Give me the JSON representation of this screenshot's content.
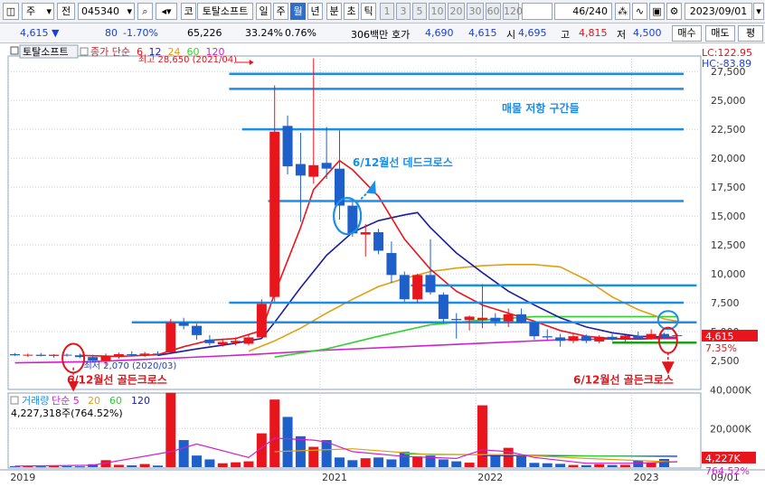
{
  "toolbar": {
    "type_label": "주",
    "prev_label": "전",
    "code": "045340",
    "name": "토탈소프트",
    "periods": [
      "일",
      "주",
      "월",
      "년",
      "분",
      "초",
      "틱"
    ],
    "selected_period": "월",
    "intervals": [
      "1",
      "3",
      "5",
      "10",
      "20",
      "30",
      "60",
      "120"
    ],
    "count": "46",
    "count_total": "/240",
    "date": "2023/09/01",
    "code_prefix": "코"
  },
  "quote": {
    "price": "4,615",
    "change": "80",
    "change_pct": "-1.70%",
    "volume": "65,226",
    "turnover": "33.24%",
    "pct2": "0.76%",
    "amount": "306백만",
    "ask_label": "호가",
    "ask": "4,690",
    "bid": "4,615",
    "open_label": "시",
    "open": "4,695",
    "high_label": "고",
    "high": "4,815",
    "low_label": "저",
    "low": "4,500",
    "buy_label": "매수",
    "sell_label": "매도",
    "eval_label": "평"
  },
  "colors": {
    "up": "#e8161c",
    "down": "#1f5fc9",
    "ma6": "#e8161c",
    "ma12": "#1a1fa0",
    "ma24": "#e0a010",
    "ma60": "#30d030",
    "ma120": "#d020d0",
    "hline": "#1a8ee8",
    "grid": "#c8d0dc"
  },
  "chart_data": [
    {
      "type": "candlestick",
      "title": "토탈소프트",
      "legend": [
        {
          "label": "종가 단순",
          "color": "#e8161c"
        },
        {
          "label": "6",
          "color": "#e8161c"
        },
        {
          "label": "12",
          "color": "#1a1fa0"
        },
        {
          "label": "24",
          "color": "#e0a010"
        },
        {
          "label": "60",
          "color": "#30d030"
        },
        {
          "label": "120",
          "color": "#d020d0"
        }
      ],
      "ylim": [
        0,
        30000
      ],
      "yticks": [
        "2,500",
        "5,000",
        "7,500",
        "10,000",
        "12,500",
        "15,000",
        "17,500",
        "20,000",
        "22,500",
        "25,000",
        "27,500"
      ],
      "ytick_values": [
        2500,
        5000,
        7500,
        10000,
        12500,
        15000,
        17500,
        20000,
        22500,
        25000,
        27500
      ],
      "xlabels": [
        {
          "label": "2019",
          "month": 0
        },
        {
          "label": "2021",
          "month": 24
        },
        {
          "label": "2022",
          "month": 36
        },
        {
          "label": "2023",
          "month": 48
        }
      ],
      "top_right_labels": {
        "lc": "LC:122.95",
        "hc": "HC:-83.89"
      },
      "current_price_label": "4,615",
      "current_pct_label": "7.35%",
      "candles": [
        {
          "m": 0,
          "o": 3050,
          "h": 3150,
          "l": 2900,
          "c": 2950
        },
        {
          "m": 1,
          "o": 2950,
          "h": 3100,
          "l": 2800,
          "c": 3000
        },
        {
          "m": 2,
          "o": 3000,
          "h": 3150,
          "l": 2850,
          "c": 2900
        },
        {
          "m": 3,
          "o": 2900,
          "h": 3050,
          "l": 2750,
          "c": 3000
        },
        {
          "m": 4,
          "o": 3000,
          "h": 3100,
          "l": 2850,
          "c": 2950
        },
        {
          "m": 5,
          "o": 2950,
          "h": 3100,
          "l": 2700,
          "c": 2800
        },
        {
          "m": 6,
          "o": 2800,
          "h": 3000,
          "l": 2300,
          "c": 2500
        },
        {
          "m": 7,
          "o": 2500,
          "h": 3100,
          "l": 2070,
          "c": 2900
        },
        {
          "m": 8,
          "o": 2900,
          "h": 3200,
          "l": 2650,
          "c": 3050
        },
        {
          "m": 9,
          "o": 3050,
          "h": 3300,
          "l": 2850,
          "c": 3000
        },
        {
          "m": 10,
          "o": 3000,
          "h": 3250,
          "l": 2800,
          "c": 3100
        },
        {
          "m": 11,
          "o": 3100,
          "h": 3300,
          "l": 2900,
          "c": 3050
        },
        {
          "m": 12,
          "o": 3200,
          "h": 6100,
          "l": 3150,
          "c": 5800
        },
        {
          "m": 13,
          "o": 5800,
          "h": 6200,
          "l": 5200,
          "c": 5500
        },
        {
          "m": 14,
          "o": 5500,
          "h": 5700,
          "l": 4300,
          "c": 4700
        },
        {
          "m": 15,
          "o": 4300,
          "h": 4700,
          "l": 3800,
          "c": 4000
        },
        {
          "m": 16,
          "o": 3900,
          "h": 4400,
          "l": 3700,
          "c": 4100
        },
        {
          "m": 17,
          "o": 4050,
          "h": 4500,
          "l": 3800,
          "c": 4200
        },
        {
          "m": 18,
          "o": 3950,
          "h": 4800,
          "l": 3800,
          "c": 4500
        },
        {
          "m": 19,
          "o": 4500,
          "h": 7800,
          "l": 4400,
          "c": 7400
        },
        {
          "m": 20,
          "o": 8000,
          "h": 26300,
          "l": 7600,
          "c": 22300
        },
        {
          "m": 21,
          "o": 22800,
          "h": 23700,
          "l": 18600,
          "c": 19300
        },
        {
          "m": 22,
          "o": 19500,
          "h": 22200,
          "l": 14500,
          "c": 18500
        },
        {
          "m": 23,
          "o": 18400,
          "h": 28650,
          "l": 17800,
          "c": 19400
        },
        {
          "m": 24,
          "o": 19600,
          "h": 22700,
          "l": 18200,
          "c": 19100
        },
        {
          "m": 25,
          "o": 19100,
          "h": 22400,
          "l": 14700,
          "c": 15900
        },
        {
          "m": 26,
          "o": 15900,
          "h": 16200,
          "l": 13200,
          "c": 13500
        },
        {
          "m": 27,
          "o": 13400,
          "h": 14300,
          "l": 11500,
          "c": 13600
        },
        {
          "m": 28,
          "o": 13600,
          "h": 13900,
          "l": 11700,
          "c": 12000
        },
        {
          "m": 29,
          "o": 11800,
          "h": 12800,
          "l": 9200,
          "c": 9900
        },
        {
          "m": 30,
          "o": 9900,
          "h": 10200,
          "l": 7600,
          "c": 7800
        },
        {
          "m": 31,
          "o": 7800,
          "h": 10000,
          "l": 7500,
          "c": 9900
        },
        {
          "m": 32,
          "o": 9900,
          "h": 13000,
          "l": 8200,
          "c": 8400
        },
        {
          "m": 33,
          "o": 8200,
          "h": 8400,
          "l": 5800,
          "c": 6100
        },
        {
          "m": 34,
          "o": 6100,
          "h": 6600,
          "l": 4400,
          "c": 6000
        },
        {
          "m": 35,
          "o": 6000,
          "h": 6400,
          "l": 5100,
          "c": 6300
        },
        {
          "m": 36,
          "o": 6000,
          "h": 9100,
          "l": 5300,
          "c": 6200
        },
        {
          "m": 37,
          "o": 6200,
          "h": 6600,
          "l": 5500,
          "c": 5900
        },
        {
          "m": 38,
          "o": 5900,
          "h": 7000,
          "l": 5400,
          "c": 6500
        },
        {
          "m": 39,
          "o": 6500,
          "h": 7000,
          "l": 5700,
          "c": 5800
        },
        {
          "m": 40,
          "o": 5800,
          "h": 5900,
          "l": 4300,
          "c": 4600
        },
        {
          "m": 41,
          "o": 4600,
          "h": 5200,
          "l": 4200,
          "c": 4500
        },
        {
          "m": 42,
          "o": 4500,
          "h": 4800,
          "l": 3700,
          "c": 4200
        },
        {
          "m": 43,
          "o": 4200,
          "h": 4800,
          "l": 4000,
          "c": 4600
        },
        {
          "m": 44,
          "o": 4600,
          "h": 4750,
          "l": 4000,
          "c": 4200
        },
        {
          "m": 45,
          "o": 4150,
          "h": 4700,
          "l": 4000,
          "c": 4550
        },
        {
          "m": 46,
          "o": 4550,
          "h": 4800,
          "l": 4200,
          "c": 4300
        },
        {
          "m": 47,
          "o": 4300,
          "h": 4700,
          "l": 4100,
          "c": 4650
        },
        {
          "m": 48,
          "o": 4650,
          "h": 5000,
          "l": 4300,
          "c": 4400
        },
        {
          "m": 49,
          "o": 4400,
          "h": 5200,
          "l": 4300,
          "c": 4800
        },
        {
          "m": 50,
          "o": 4800,
          "h": 4900,
          "l": 4350,
          "c": 4500
        },
        {
          "m": 51,
          "o": 4695,
          "h": 4815,
          "l": 4500,
          "c": 4615
        }
      ],
      "ma6": [
        [
          5,
          2950
        ],
        [
          8,
          2850
        ],
        [
          11,
          3000
        ],
        [
          13,
          3700
        ],
        [
          15,
          4250
        ],
        [
          17,
          4400
        ],
        [
          19,
          5100
        ],
        [
          20,
          8300
        ],
        [
          22,
          14000
        ],
        [
          23,
          17300
        ],
        [
          25,
          19800
        ],
        [
          26,
          19000
        ],
        [
          28,
          16700
        ],
        [
          30,
          13000
        ],
        [
          32,
          10400
        ],
        [
          34,
          8500
        ],
        [
          36,
          7300
        ],
        [
          38,
          6600
        ],
        [
          40,
          5900
        ],
        [
          42,
          5100
        ],
        [
          44,
          4600
        ],
        [
          46,
          4400
        ],
        [
          48,
          4350
        ],
        [
          51,
          4500
        ]
      ],
      "ma12": [
        [
          11,
          2950
        ],
        [
          14,
          3500
        ],
        [
          17,
          4000
        ],
        [
          19,
          4400
        ],
        [
          20,
          5800
        ],
        [
          22,
          8800
        ],
        [
          24,
          11600
        ],
        [
          26,
          13600
        ],
        [
          28,
          14600
        ],
        [
          30,
          15100
        ],
        [
          31,
          15300
        ],
        [
          32,
          14000
        ],
        [
          34,
          11800
        ],
        [
          36,
          10100
        ],
        [
          38,
          8500
        ],
        [
          40,
          7300
        ],
        [
          42,
          6200
        ],
        [
          44,
          5400
        ],
        [
          46,
          4900
        ],
        [
          48,
          4600
        ],
        [
          51,
          4500
        ]
      ],
      "ma24": [
        [
          18,
          3300
        ],
        [
          20,
          4200
        ],
        [
          22,
          5300
        ],
        [
          24,
          6600
        ],
        [
          26,
          7800
        ],
        [
          28,
          8900
        ],
        [
          30,
          9600
        ],
        [
          32,
          10200
        ],
        [
          34,
          10500
        ],
        [
          36,
          10700
        ],
        [
          38,
          10800
        ],
        [
          40,
          10800
        ],
        [
          42,
          10600
        ],
        [
          44,
          9500
        ],
        [
          46,
          8000
        ],
        [
          48,
          6900
        ],
        [
          50,
          6100
        ],
        [
          51,
          5900
        ]
      ],
      "ma60": [
        [
          20,
          2800
        ],
        [
          24,
          3500
        ],
        [
          28,
          4600
        ],
        [
          32,
          5600
        ],
        [
          36,
          6000
        ],
        [
          40,
          6300
        ],
        [
          44,
          6300
        ],
        [
          48,
          6300
        ],
        [
          51,
          6300
        ]
      ],
      "ma120": [
        [
          0,
          2300
        ],
        [
          6,
          2400
        ],
        [
          12,
          2700
        ],
        [
          18,
          3000
        ],
        [
          24,
          3400
        ],
        [
          30,
          3700
        ],
        [
          36,
          4000
        ],
        [
          42,
          4300
        ],
        [
          48,
          4400
        ],
        [
          51,
          4400
        ]
      ],
      "hlines": [
        {
          "m0": 16.5,
          "m1": 51.5,
          "v": 27300
        },
        {
          "m0": 16.5,
          "m1": 51.5,
          "v": 26000
        },
        {
          "m0": 17.5,
          "m1": 51.5,
          "v": 22500
        },
        {
          "m0": 19.5,
          "m1": 51.5,
          "v": 16300
        },
        {
          "m0": 30.5,
          "m1": 52.5,
          "v": 9000
        },
        {
          "m0": 16.5,
          "m1": 51.5,
          "v": 7500
        },
        {
          "m0": 9,
          "m1": 52.5,
          "v": 5800
        }
      ],
      "greenline": {
        "m0": 46,
        "m1": 52.5,
        "v": 4050
      },
      "annotations": [
        {
          "text": "매물 저항 구간들",
          "m": 37.5,
          "v": 24000,
          "color": "#1a8ee8",
          "size": 12
        },
        {
          "text": "6/12월선 데드크로스",
          "m": 26,
          "v": 19300,
          "color": "#1a8ee8",
          "size": 12
        },
        {
          "text": "6/12월선 골든크로스",
          "m": 4,
          "v": 500,
          "color": "#e0161c",
          "size": 12
        },
        {
          "text": "6/12월선 골든크로스",
          "m": 43,
          "v": 500,
          "color": "#e0161c",
          "size": 12
        },
        {
          "text": "최고 28,650 (2021/04)",
          "m": 9.5,
          "v": 28300,
          "color": "#e0161c",
          "size": 10
        },
        {
          "text": "최저 2,070 (2020/03)",
          "m": 5.3,
          "v": 1800,
          "color": "#1a3fd6",
          "size": 10
        }
      ]
    },
    {
      "type": "bar",
      "title": "거래량",
      "legend": [
        {
          "label": "거래량",
          "color": "#1a8ee8"
        },
        {
          "label": "단순 5",
          "color": "#d020d0"
        },
        {
          "label": "20",
          "color": "#e0a010"
        },
        {
          "label": "60",
          "color": "#30d030"
        },
        {
          "label": "120",
          "color": "#1a1fa0"
        }
      ],
      "ylim": [
        0,
        40000
      ],
      "yticks": [
        "20,000K",
        "40,000K"
      ],
      "ytick_values": [
        20000,
        40000
      ],
      "last_volume_text": "4,227,318주(764.52%)",
      "last_volume_label": "4,227K",
      "last_pct_label": "764.52%",
      "x_date_label": "09/01",
      "volumes": [
        500,
        600,
        400,
        500,
        500,
        400,
        1500,
        3600,
        1200,
        900,
        1600,
        800,
        38500,
        14000,
        6000,
        4000,
        2000,
        2500,
        3000,
        17500,
        35000,
        26000,
        16000,
        10500,
        14000,
        5000,
        3600,
        4600,
        5000,
        4000,
        8000,
        5500,
        6000,
        4000,
        3000,
        2300,
        32000,
        6000,
        10000,
        6000,
        2200,
        2000,
        1700,
        1100,
        1000,
        1500,
        1100,
        1200,
        3500,
        2500,
        4227
      ],
      "vol_ma5": [
        [
          0,
          500
        ],
        [
          6,
          1000
        ],
        [
          12,
          8000
        ],
        [
          14,
          12000
        ],
        [
          18,
          5000
        ],
        [
          20,
          15000
        ],
        [
          23,
          14000
        ],
        [
          24,
          13000
        ],
        [
          26,
          8000
        ],
        [
          30,
          5500
        ],
        [
          34,
          4500
        ],
        [
          36,
          9000
        ],
        [
          38,
          8000
        ],
        [
          40,
          5000
        ],
        [
          44,
          2000
        ],
        [
          48,
          2000
        ],
        [
          51,
          2800
        ]
      ],
      "vol_ma20": [
        [
          20,
          8000
        ],
        [
          26,
          9500
        ],
        [
          32,
          6500
        ],
        [
          38,
          6500
        ],
        [
          44,
          4500
        ],
        [
          51,
          2600
        ]
      ],
      "vol_ma60": [
        [
          30,
          6800
        ],
        [
          40,
          6200
        ],
        [
          51,
          5300
        ]
      ],
      "vol_ma120": [
        [
          36,
          6000
        ],
        [
          51,
          5600
        ]
      ]
    }
  ]
}
